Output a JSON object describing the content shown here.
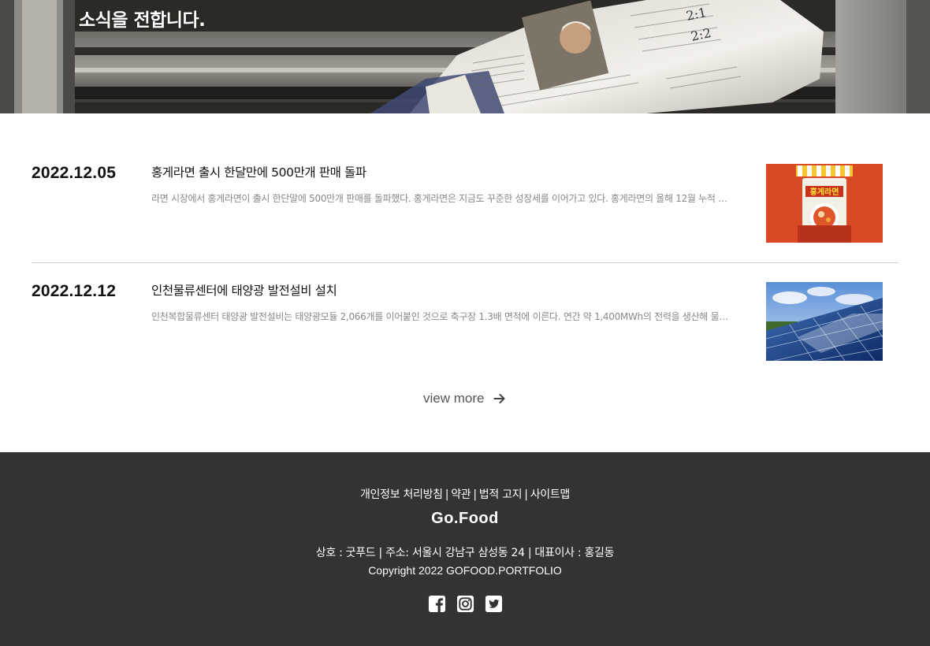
{
  "hero": {
    "title": "소식을 전합니다."
  },
  "news": [
    {
      "date": "2022.12.05",
      "title": "홍게라면 출시 한달만에 500만개 판매 돌파",
      "description": "라면 시장에서 홍게라면이 출시 한단말에 500만개 판매를 돌파했다. 홍게라면은 지금도 꾸준한 성장세를 이어가고 있다. 홍게라면의 올해 12월 누적 매...",
      "thumbnail": "noodle-package-image",
      "thumb_label": "홍게라면"
    },
    {
      "date": "2022.12.12",
      "title": "인천물류센터에 태양광 발전설비 설치",
      "description": "인천복합물류센터 태양광 발전설비는 태양광모듈 2,066개를 이어붙인 것으로 축구장 1.3배 면적에 이른다. 연간 약 1,400MWh의 전력을 생산해 물류...",
      "thumbnail": "solar-panel-image"
    }
  ],
  "view_more": {
    "label": "view more",
    "icon": "arrow-right-icon"
  },
  "footer": {
    "links": [
      "개인정보 처리방침",
      "약관",
      "법적 고지",
      "사이트맵"
    ],
    "separator": "|",
    "brand": "Go.Food",
    "info": "상호 : 굿푸드 | 주소: 서울시 강남구 삼성동 24 | 대표이사 : 홍길동",
    "copyright": "Copyright 2022 GOFOOD.PORTFOLIO",
    "social": [
      "facebook-icon",
      "instagram-icon",
      "twitter-icon"
    ]
  },
  "colors": {
    "footer_bg": "#333333",
    "thumb_orange": "#d94a24",
    "text_muted": "#888888"
  }
}
